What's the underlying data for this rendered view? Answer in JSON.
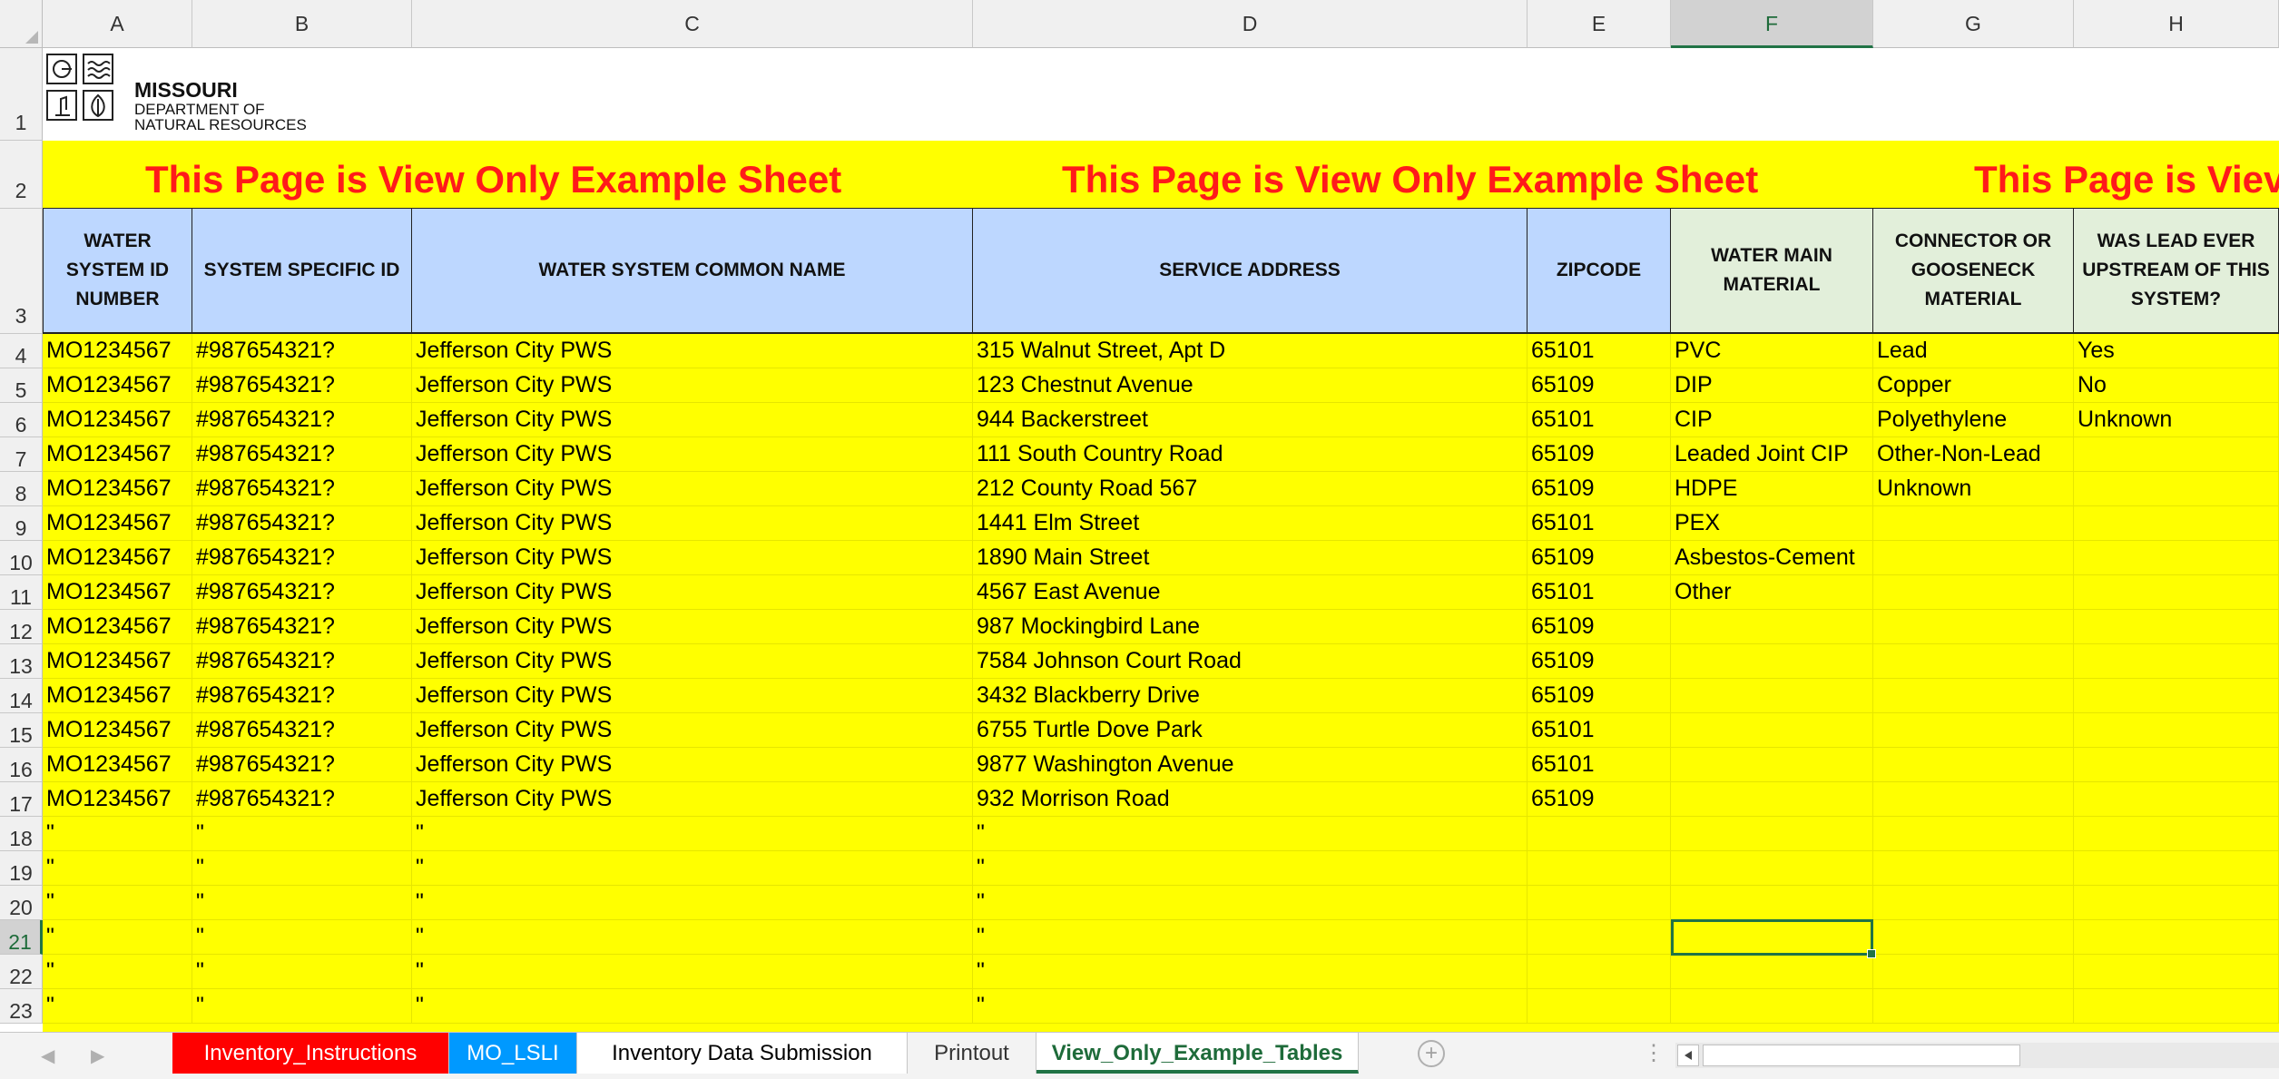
{
  "columns": [
    "A",
    "B",
    "C",
    "D",
    "E",
    "F",
    "G",
    "H"
  ],
  "selected_column": "F",
  "selected_row": "21",
  "logo": {
    "brand": "MISSOURI",
    "line2": "DEPARTMENT OF",
    "line3": "NATURAL RESOURCES"
  },
  "banner": {
    "text": "This Page is View Only Example Sheet",
    "text_truncated": "This Page is Viev"
  },
  "headers": [
    "WATER SYSTEM ID NUMBER",
    "SYSTEM SPECIFIC ID",
    "WATER SYSTEM COMMON NAME",
    "SERVICE ADDRESS",
    "ZIPCODE",
    "WATER MAIN MATERIAL",
    "CONNECTOR OR GOOSENECK MATERIAL",
    "WAS LEAD EVER UPSTREAM OF THIS SYSTEM?"
  ],
  "rows": [
    {
      "n": "4",
      "a": "MO1234567",
      "b": "#987654321?",
      "c": "Jefferson City PWS",
      "d": "315 Walnut Street, Apt D",
      "e": "65101",
      "f": "PVC",
      "g": "Lead",
      "h": "Yes"
    },
    {
      "n": "5",
      "a": "MO1234567",
      "b": "#987654321?",
      "c": "Jefferson City PWS",
      "d": "123 Chestnut Avenue",
      "e": "65109",
      "f": "DIP",
      "g": "Copper",
      "h": "No"
    },
    {
      "n": "6",
      "a": "MO1234567",
      "b": "#987654321?",
      "c": "Jefferson City PWS",
      "d": "944 Backerstreet",
      "e": "65101",
      "f": "CIP",
      "g": "Polyethylene",
      "h": "Unknown"
    },
    {
      "n": "7",
      "a": "MO1234567",
      "b": "#987654321?",
      "c": "Jefferson City PWS",
      "d": "111 South Country Road",
      "e": "65109",
      "f": "Leaded Joint CIP",
      "g": "Other-Non-Lead",
      "h": ""
    },
    {
      "n": "8",
      "a": "MO1234567",
      "b": "#987654321?",
      "c": "Jefferson City PWS",
      "d": "212 County Road 567",
      "e": "65109",
      "f": "HDPE",
      "g": "Unknown",
      "h": ""
    },
    {
      "n": "9",
      "a": "MO1234567",
      "b": "#987654321?",
      "c": "Jefferson City PWS",
      "d": "1441 Elm Street",
      "e": "65101",
      "f": "PEX",
      "g": "",
      "h": ""
    },
    {
      "n": "10",
      "a": "MO1234567",
      "b": "#987654321?",
      "c": "Jefferson City PWS",
      "d": "1890 Main Street",
      "e": "65109",
      "f": "Asbestos-Cement",
      "g": "",
      "h": ""
    },
    {
      "n": "11",
      "a": "MO1234567",
      "b": "#987654321?",
      "c": "Jefferson City PWS",
      "d": "4567 East Avenue",
      "e": "65101",
      "f": "Other",
      "g": "",
      "h": ""
    },
    {
      "n": "12",
      "a": "MO1234567",
      "b": "#987654321?",
      "c": "Jefferson City PWS",
      "d": "987 Mockingbird Lane",
      "e": "65109",
      "f": "",
      "g": "",
      "h": ""
    },
    {
      "n": "13",
      "a": "MO1234567",
      "b": "#987654321?",
      "c": "Jefferson City PWS",
      "d": "7584 Johnson Court Road",
      "e": "65109",
      "f": "",
      "g": "",
      "h": ""
    },
    {
      "n": "14",
      "a": "MO1234567",
      "b": "#987654321?",
      "c": "Jefferson City PWS",
      "d": "3432 Blackberry Drive",
      "e": "65109",
      "f": "",
      "g": "",
      "h": ""
    },
    {
      "n": "15",
      "a": "MO1234567",
      "b": "#987654321?",
      "c": "Jefferson City PWS",
      "d": "6755 Turtle Dove Park",
      "e": "65101",
      "f": "",
      "g": "",
      "h": ""
    },
    {
      "n": "16",
      "a": "MO1234567",
      "b": "#987654321?",
      "c": "Jefferson City PWS",
      "d": "9877 Washington Avenue",
      "e": "65101",
      "f": "",
      "g": "",
      "h": ""
    },
    {
      "n": "17",
      "a": "MO1234567",
      "b": "#987654321?",
      "c": "Jefferson City PWS",
      "d": "932 Morrison Road",
      "e": "65109",
      "f": "",
      "g": "",
      "h": ""
    },
    {
      "n": "18",
      "a": "\"",
      "b": "\"",
      "c": "\"",
      "d": "\"",
      "e": "",
      "f": "",
      "g": "",
      "h": ""
    },
    {
      "n": "19",
      "a": "\"",
      "b": "\"",
      "c": "\"",
      "d": "\"",
      "e": "",
      "f": "",
      "g": "",
      "h": ""
    },
    {
      "n": "20",
      "a": "\"",
      "b": "\"",
      "c": "\"",
      "d": "\"",
      "e": "",
      "f": "",
      "g": "",
      "h": ""
    },
    {
      "n": "21",
      "a": "\"",
      "b": "\"",
      "c": "\"",
      "d": "\"",
      "e": "",
      "f": "",
      "g": "",
      "h": ""
    },
    {
      "n": "22",
      "a": "\"",
      "b": "\"",
      "c": "\"",
      "d": "\"",
      "e": "",
      "f": "",
      "g": "",
      "h": ""
    },
    {
      "n": "23",
      "a": "\"",
      "b": "\"",
      "c": "\"",
      "d": "\"",
      "e": "",
      "f": "",
      "g": "",
      "h": ""
    }
  ],
  "sheet_tabs": [
    {
      "label": "Inventory_Instructions",
      "color": "#ff0000",
      "text_color": "#ffffff",
      "active": false
    },
    {
      "label": "MO_LSLI",
      "color": "#0099ff",
      "text_color": "#ffffff",
      "active": false
    },
    {
      "label": "Inventory Data Submission",
      "color": "#ffffff",
      "text_color": "#000000",
      "active": false
    },
    {
      "label": "Printout",
      "color": "#f3f3f3",
      "text_color": "#333333",
      "active": false
    },
    {
      "label": "View_Only_Example_Tables",
      "color": "#ffffff",
      "text_color": "#1e6b3a",
      "active": true
    }
  ],
  "colors": {
    "body_fill": "#ffff00",
    "header_blue": "#bdd7ff",
    "header_green": "#e2efda",
    "banner_text": "#ff1a1a",
    "selection": "#217346"
  }
}
